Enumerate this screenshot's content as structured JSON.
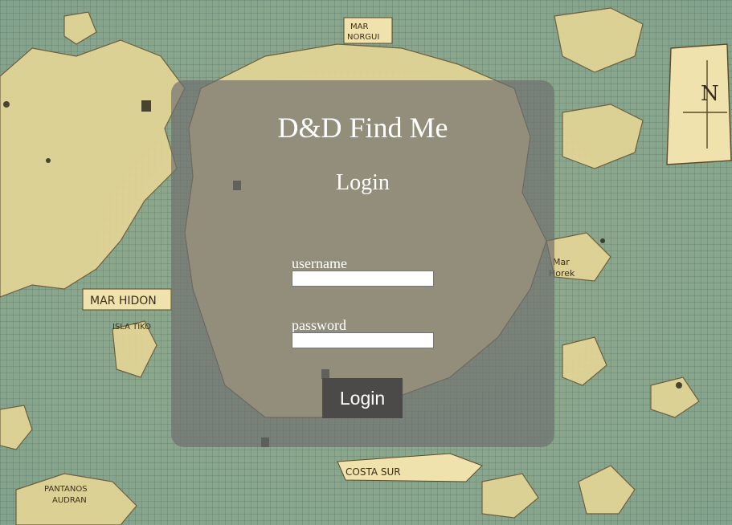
{
  "app": {
    "title": "D&D Find Me"
  },
  "login_form": {
    "heading": "Login",
    "username": {
      "label": "username",
      "value": "",
      "placeholder": ""
    },
    "password": {
      "label": "password",
      "value": "",
      "placeholder": ""
    },
    "submit_label": "Login"
  },
  "background": {
    "description_icon": "fantasy-map-image",
    "map_labels": [
      "MAR NORGUI",
      "MAR HIDON",
      "ISLA TIKO",
      "COSTA SUR",
      "PANTANOS AUDRAN",
      "Mar Horek",
      "N"
    ]
  },
  "colors": {
    "panel": "#6e6e6e",
    "button": "#4b4a48",
    "text": "#ffffff",
    "map_sea": "#89ab93",
    "map_land": "#e6d79a"
  }
}
